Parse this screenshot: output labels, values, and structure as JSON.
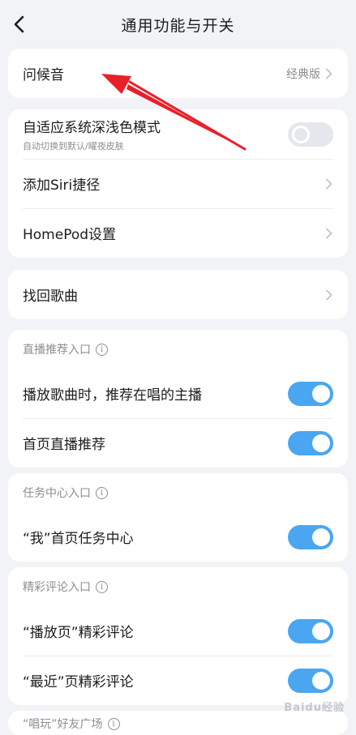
{
  "header": {
    "title": "通用功能与开关"
  },
  "cards": {
    "greeting": {
      "label": "问候音",
      "value": "经典版"
    },
    "display": {
      "adaptive_label": "自适应系统深浅色模式",
      "adaptive_sub": "自动切换到默认/曜夜皮肤",
      "adaptive_toggle": "off",
      "siri_label": "添加Siri捷径",
      "homepod_label": "HomePod设置"
    },
    "recover": {
      "label": "找回歌曲"
    },
    "live": {
      "head": "直播推荐入口",
      "item1": "播放歌曲时，推荐在唱的主播",
      "item2": "首页直播推荐"
    },
    "task": {
      "head": "任务中心入口",
      "item1": "“我”首页任务中心"
    },
    "comments": {
      "head": "精彩评论入口",
      "item1": "“播放页”精彩评论",
      "item2": "“最近”页精彩评论"
    },
    "partial": {
      "head": "“唱玩”好友广场"
    }
  },
  "watermark": "Baidu经验",
  "colors": {
    "toggle_on": "#4aa6f0",
    "annotation_arrow": "#e8202a"
  },
  "icons": {
    "back": "chevron-left-icon",
    "row": "chevron-right-icon",
    "info": "info-icon"
  }
}
